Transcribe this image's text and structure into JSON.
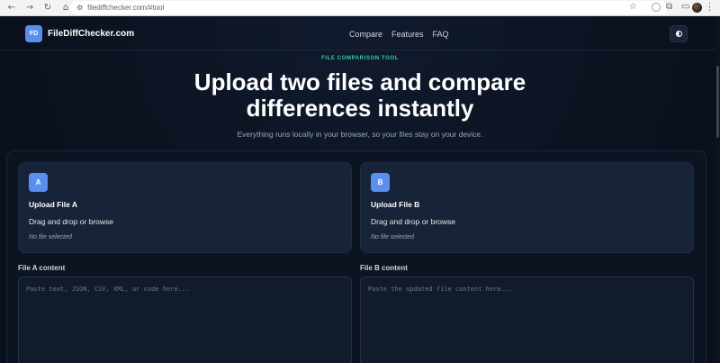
{
  "browser": {
    "url": "filediffchecker.com/#tool"
  },
  "header": {
    "logo_badge": "FD",
    "logo_text": "FileDiffChecker.com",
    "nav": [
      "Compare",
      "Features",
      "FAQ"
    ]
  },
  "hero": {
    "eyebrow": "FILE COMPARISON TOOL",
    "headline_line1": "Upload two files and compare",
    "headline_line2": "differences instantly",
    "subtitle": "Everything runs locally in your browser, so your files stay on your device."
  },
  "uploads": [
    {
      "badge": "A",
      "title": "Upload File A",
      "action": "Drag and drop or browse",
      "status": "No file selected",
      "content_label": "File A content",
      "placeholder": "Paste text, JSON, CSV, XML, or code here..."
    },
    {
      "badge": "B",
      "title": "Upload File B",
      "action": "Drag and drop or browse",
      "status": "No file selected",
      "content_label": "File B content",
      "placeholder": "Paste the updated file content here..."
    }
  ],
  "colors": {
    "accent": "#5a8ff0",
    "eyebrow": "#34d399",
    "background": "#0b1220"
  }
}
